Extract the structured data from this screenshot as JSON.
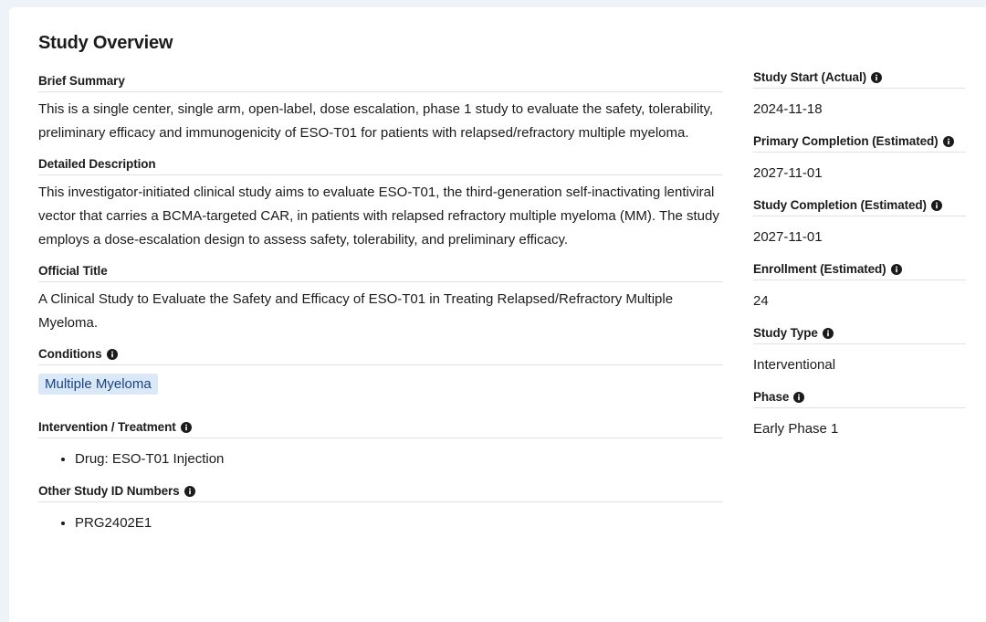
{
  "title": "Study Overview",
  "left": {
    "brief_summary": {
      "label": "Brief Summary",
      "text": "This is a single center, single arm, open-label, dose escalation, phase 1 study to evaluate the safety, tolerability, preliminary efficacy and immunogenicity of ESO-T01 for patients with relapsed/refractory multiple myeloma."
    },
    "detailed_description": {
      "label": "Detailed Description",
      "text": "This investigator-initiated clinical study aims to evaluate ESO-T01, the third-generation self-inactivating lentiviral vector that carries a BCMA-targeted CAR, in patients with relapsed refractory multiple myeloma (MM). The study employs a dose-escalation design to assess safety, tolerability, and preliminary efficacy."
    },
    "official_title": {
      "label": "Official Title",
      "text": "A Clinical Study to Evaluate the Safety and Efficacy of ESO-T01 in Treating Relapsed/Refractory Multiple Myeloma."
    },
    "conditions": {
      "label": "Conditions",
      "tags": [
        "Multiple Myeloma"
      ]
    },
    "intervention": {
      "label": "Intervention / Treatment",
      "items": [
        "Drug: ESO-T01 Injection"
      ]
    },
    "other_ids": {
      "label": "Other Study ID Numbers",
      "items": [
        "PRG2402E1"
      ]
    }
  },
  "right": {
    "study_start": {
      "label": "Study Start (Actual)",
      "value": "2024-11-18"
    },
    "primary_completion": {
      "label": "Primary Completion (Estimated)",
      "value": "2027-11-01"
    },
    "study_completion": {
      "label": "Study Completion (Estimated)",
      "value": "2027-11-01"
    },
    "enrollment": {
      "label": "Enrollment (Estimated)",
      "value": "24"
    },
    "study_type": {
      "label": "Study Type",
      "value": "Interventional"
    },
    "phase": {
      "label": "Phase",
      "value": "Early Phase 1"
    }
  },
  "icons": {
    "info": "info-circle-icon"
  },
  "colors": {
    "tag_bg": "#dbe8f8",
    "tag_text": "#1a4480",
    "divider": "#dfe1e2",
    "info_icon": "#1b1b1b"
  }
}
